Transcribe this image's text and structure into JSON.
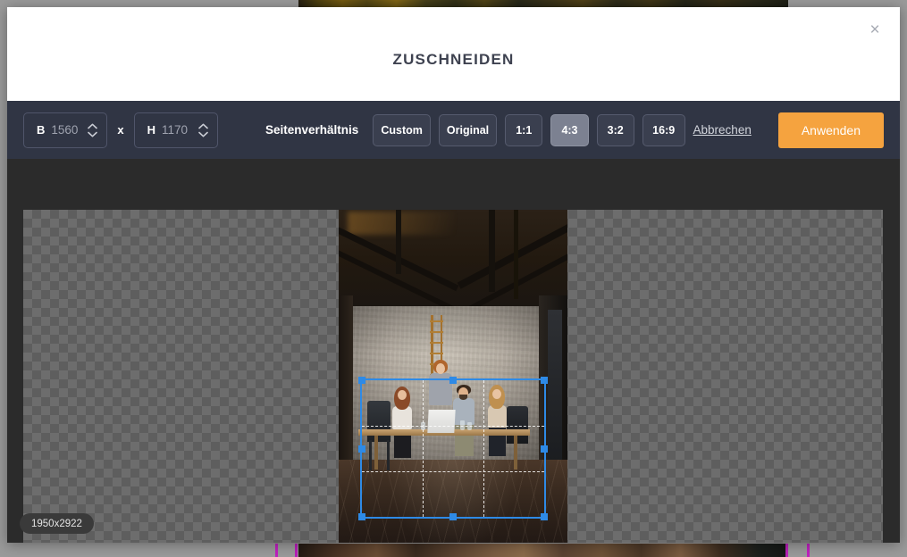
{
  "modal": {
    "title": "ZUSCHNEIDEN",
    "close_label": "×"
  },
  "toolbar": {
    "width_label": "B",
    "width_value": "1560",
    "separator": "x",
    "height_label": "H",
    "height_value": "1170",
    "aspect_ratio_label": "Seitenverhältnis",
    "ratios": [
      {
        "label": "Custom",
        "active": false
      },
      {
        "label": "Original",
        "active": false
      },
      {
        "label": "1:1",
        "active": false
      },
      {
        "label": "4:3",
        "active": true
      },
      {
        "label": "3:2",
        "active": false
      },
      {
        "label": "16:9",
        "active": false
      }
    ],
    "cancel_label": "Abbrechen",
    "apply_label": "Anwenden"
  },
  "canvas": {
    "size_badge": "1950x2922",
    "crop_selection": {
      "aspect": "4:3",
      "grid_lines": 2
    }
  },
  "colors": {
    "accent_orange": "#f5a33f",
    "crop_blue": "#2e8ae6",
    "header_bg": "#ffffff",
    "toolbar_bg": "#303544",
    "canvas_bg": "#2b2b2b",
    "title_text": "#3e4250"
  }
}
